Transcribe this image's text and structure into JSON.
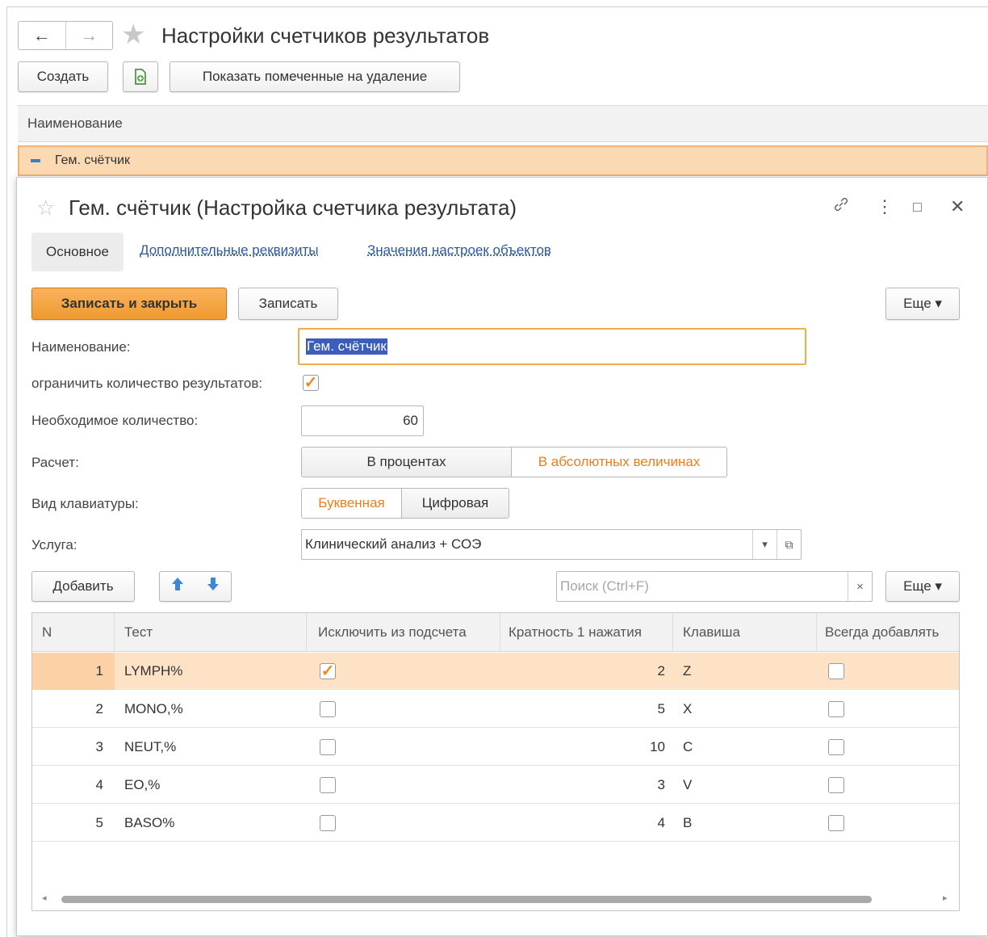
{
  "window": {
    "title": "Настройки счетчиков результатов",
    "back_icon": "←",
    "forward_icon": "→",
    "star_icon": "★"
  },
  "toolbar": {
    "create_label": "Создать",
    "copy_icon": "copy-icon",
    "show_deleted_label": "Показать помеченные на удаление"
  },
  "list": {
    "column_header": "Наименование",
    "rows": [
      {
        "label": "Гем. счётчик"
      }
    ]
  },
  "dialog": {
    "title": "Гем. счётчик (Настройка счетчика результата)",
    "star_icon": "☆",
    "link_icon": "🔗",
    "more_icon": "⋮",
    "maximize_icon": "□",
    "close_icon": "✕",
    "tabs": [
      {
        "label": "Основное",
        "active": true
      },
      {
        "label": "Дополнительные реквизиты",
        "active": false
      },
      {
        "label": "Значения настроек объектов",
        "active": false
      }
    ],
    "buttons": {
      "save_close": "Записать и закрыть",
      "save": "Записать",
      "more": "Еще ▾"
    },
    "form": {
      "name_label": "Наименование:",
      "name_value": "Гем. счётчик",
      "limit_label": "ограничить количество результатов:",
      "limit_checked": true,
      "required_label": "Необходимое количество:",
      "required_value": "60",
      "calc_label": "Расчет:",
      "calc_options": [
        "В процентах",
        "В абсолютных величинах"
      ],
      "calc_selected": "В абсолютных величинах",
      "keyboard_label": "Вид клавиатуры:",
      "keyboard_options": [
        "Буквенная",
        "Цифровая"
      ],
      "keyboard_selected": "Буквенная",
      "service_label": "Услуга:",
      "service_value": "Клинический анализ + СОЭ",
      "dropdown_icon": "▾",
      "open_icon": "⧉"
    },
    "table_toolbar": {
      "add_label": "Добавить",
      "up_icon": "🡅",
      "down_icon": "🡇",
      "search_placeholder": "Поиск (Ctrl+F)",
      "clear_icon": "×",
      "more_label": "Еще ▾"
    },
    "table": {
      "columns": [
        "N",
        "Тест",
        "Исключить из подсчета",
        "Кратность 1 нажатия",
        "Клавиша",
        "Всегда добавлять"
      ],
      "rows": [
        {
          "n": "1",
          "test": "LYMPH%",
          "exclude": true,
          "multiplicity": "2",
          "key": "Z",
          "always": false
        },
        {
          "n": "2",
          "test": "MONO,%",
          "exclude": false,
          "multiplicity": "5",
          "key": "X",
          "always": false
        },
        {
          "n": "3",
          "test": "NEUT,%",
          "exclude": false,
          "multiplicity": "10",
          "key": "C",
          "always": false
        },
        {
          "n": "4",
          "test": "EO,%",
          "exclude": false,
          "multiplicity": "3",
          "key": "V",
          "always": false
        },
        {
          "n": "5",
          "test": "BASO%",
          "exclude": false,
          "multiplicity": "4",
          "key": "B",
          "always": false
        }
      ],
      "selected_row": 0,
      "scroll_left_icon": "◂",
      "scroll_right_icon": "▸"
    }
  },
  "colors": {
    "accent_orange": "#f07d1a",
    "primary_button": "#ee9a2f",
    "selected_row": "#fde2c5",
    "link_blue": "#2c5aa0"
  }
}
